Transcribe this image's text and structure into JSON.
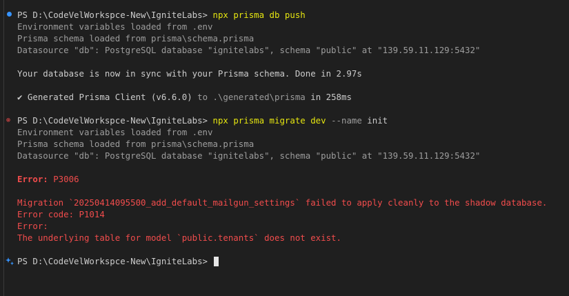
{
  "prompt": "PS D:\\CodeVelWorkspce-New\\IgniteLabs> ",
  "block1": {
    "cmd": "npx prisma db push",
    "env": "Environment variables loaded from .env",
    "schema": "Prisma schema loaded from prisma\\schema.prisma",
    "datasource": "Datasource \"db\": PostgreSQL database \"ignitelabs\", schema \"public\" at \"139.59.11.129:5432\"",
    "sync": "Your database is now in sync with your Prisma schema. Done in 2.97s",
    "check": "✔",
    "gen_a": " Generated Prisma Client",
    "gen_b": " (v6.6.0)",
    "gen_c": " to .\\generated\\prisma",
    "gen_d": " in 258ms"
  },
  "block2": {
    "cmd": "npx prisma migrate dev",
    "flag": " --name",
    "arg": " init",
    "env": "Environment variables loaded from .env",
    "schema": "Prisma schema loaded from prisma\\schema.prisma",
    "datasource": "Datasource \"db\": PostgreSQL database \"ignitelabs\", schema \"public\" at \"139.59.11.129:5432\"",
    "error_label": "Error:",
    "error_code": " P3006",
    "migration": "Migration `20250414095500_add_default_mailgun_settings` failed to apply cleanly to the shadow database.",
    "code_line": "Error code: P1014",
    "error2": "Error:",
    "detail": "The underlying table for model `public.tenants` does not exist."
  },
  "colors": {
    "background": "#1f1f1f",
    "command": "#e5e510",
    "error": "#f14c4c",
    "success_dot": "#3794ff"
  }
}
